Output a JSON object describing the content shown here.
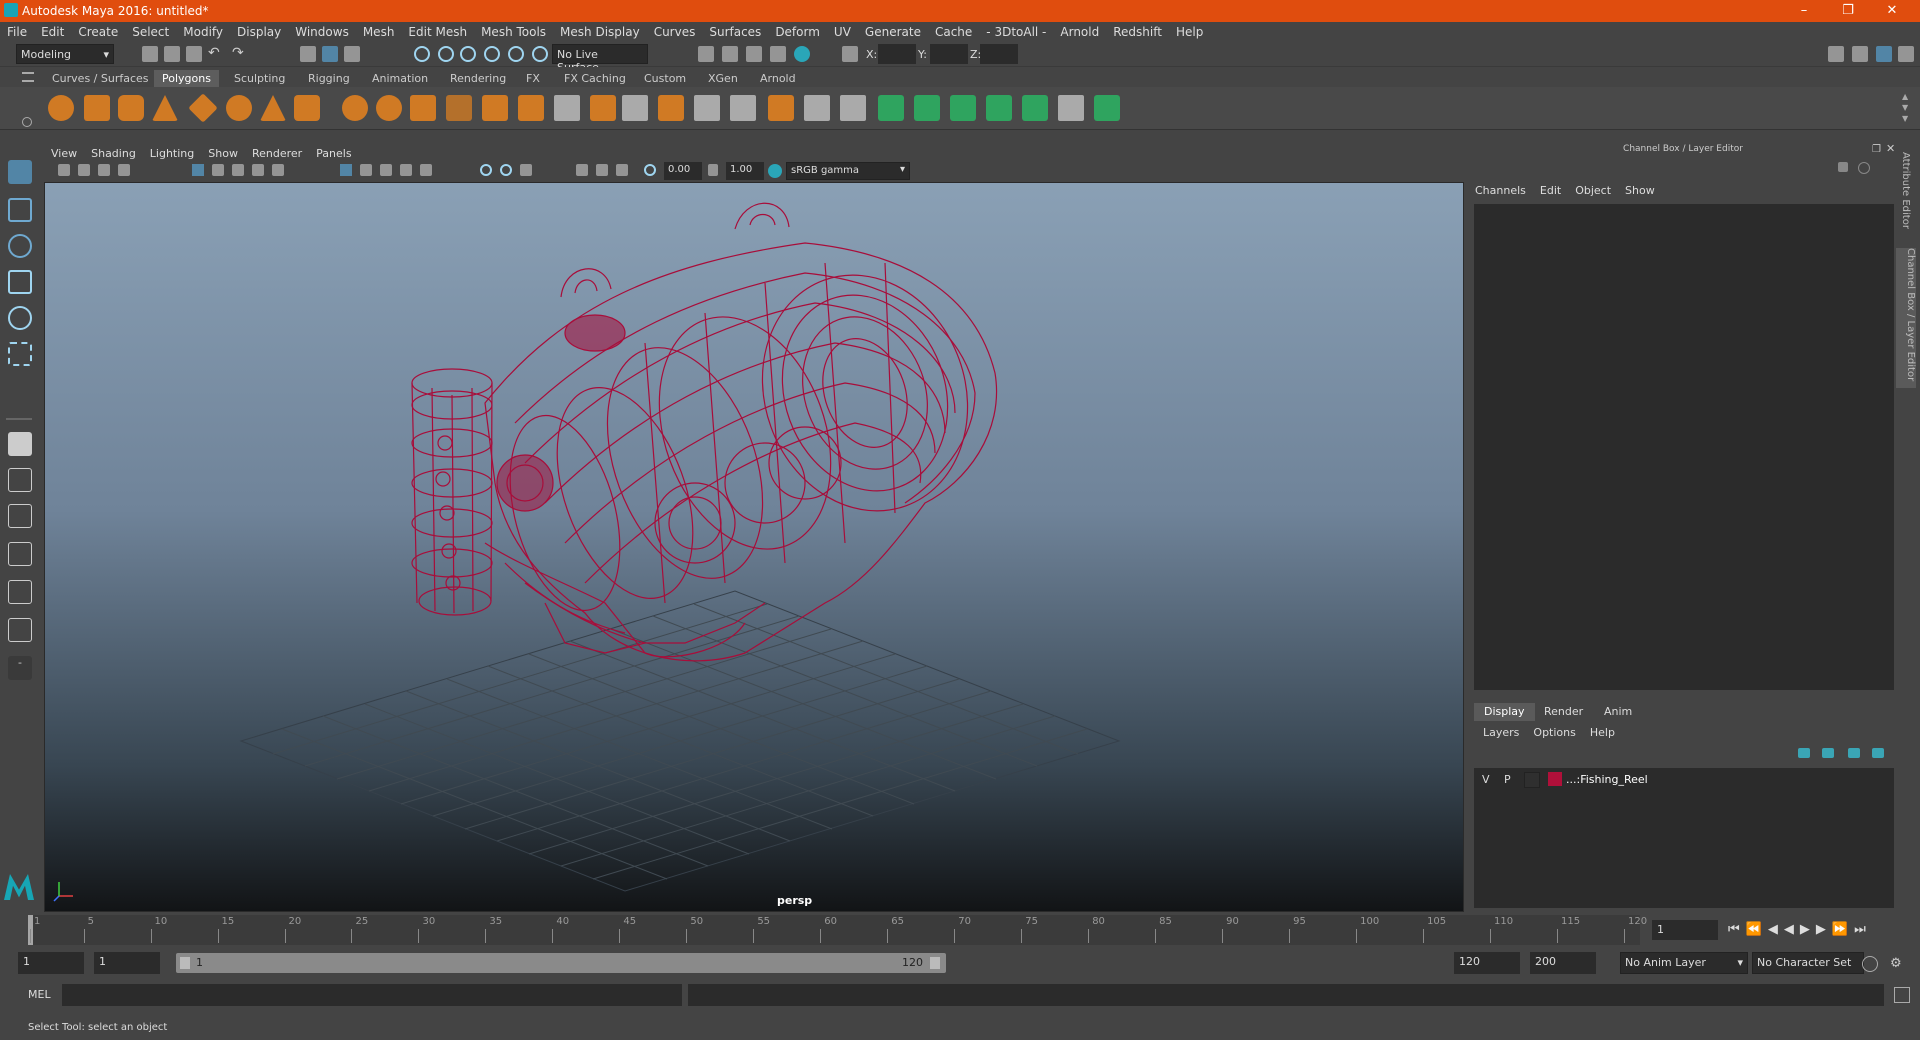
{
  "window": {
    "title": "Autodesk Maya 2016: untitled*"
  },
  "menus": [
    "File",
    "Edit",
    "Create",
    "Select",
    "Modify",
    "Display",
    "Windows",
    "Mesh",
    "Edit Mesh",
    "Mesh Tools",
    "Mesh Display",
    "Curves",
    "Surfaces",
    "Deform",
    "UV",
    "Generate",
    "Cache",
    "- 3DtoAll -",
    "Arnold",
    "Redshift",
    "Help"
  ],
  "status": {
    "mode": "Modeling",
    "live_surface": "No Live Surface",
    "x_label": "X:",
    "y_label": "Y:",
    "z_label": "Z:"
  },
  "shelf_tabs": [
    "Curves / Surfaces",
    "Polygons",
    "Sculpting",
    "Rigging",
    "Animation",
    "Rendering",
    "FX",
    "FX Caching",
    "Custom",
    "XGen",
    "Arnold"
  ],
  "shelf_active": "Polygons",
  "viewport": {
    "menus": [
      "View",
      "Shading",
      "Lighting",
      "Show",
      "Renderer",
      "Panels"
    ],
    "exposure": "0.00",
    "gamma": "1.00",
    "color_space": "sRGB gamma",
    "camera_label": "persp"
  },
  "channel_box": {
    "title": "Channel Box / Layer Editor",
    "menus": [
      "Channels",
      "Edit",
      "Object",
      "Show"
    ]
  },
  "side_tabs": [
    "Attribute Editor",
    "Channel Box / Layer Editor"
  ],
  "layer_editor": {
    "tabs": [
      "Display",
      "Render",
      "Anim"
    ],
    "active_tab": "Display",
    "menus": [
      "Layers",
      "Options",
      "Help"
    ],
    "layers": [
      {
        "v": "V",
        "p": "P",
        "name": "...:Fishing_Reel",
        "color": "#b0103a"
      }
    ]
  },
  "time_slider": {
    "ticks": [
      "1",
      "5",
      "10",
      "15",
      "20",
      "25",
      "30",
      "35",
      "40",
      "45",
      "50",
      "55",
      "60",
      "65",
      "70",
      "75",
      "80",
      "85",
      "90",
      "95",
      "100",
      "105",
      "110",
      "115",
      "120"
    ],
    "current_frame": "1"
  },
  "range": {
    "start": "1",
    "playback_start": "1",
    "range_start_label": "1",
    "range_end_label": "120",
    "playback_end": "120",
    "end": "200",
    "anim_layer": "No Anim Layer",
    "character_set": "No Character Set"
  },
  "command_line": {
    "label": "MEL"
  },
  "help_line": {
    "text": "Select Tool: select an object"
  },
  "colors": {
    "title_bar": "#e04d0e",
    "wireframe": "#b0103a",
    "accent": "#5285a6"
  }
}
